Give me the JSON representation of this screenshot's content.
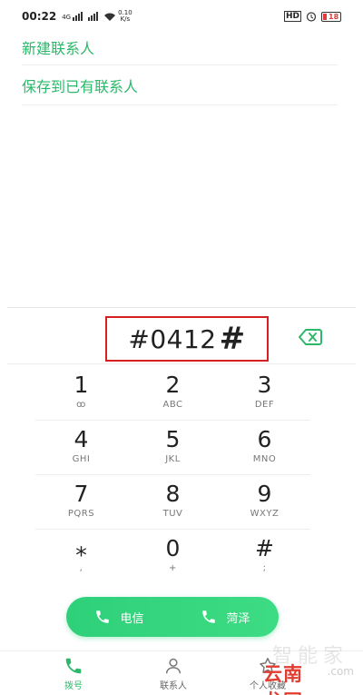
{
  "status_bar": {
    "time": "00:22",
    "net_label": "4G",
    "speed_value": "0.10",
    "speed_unit": "K/s",
    "hd": "HD",
    "battery": "18"
  },
  "suggestions": {
    "new_contact": "新建联系人",
    "save_existing": "保存到已有联系人"
  },
  "dialer": {
    "number": "#0412",
    "hash": "#"
  },
  "keypad": [
    {
      "digit": "1",
      "letters": "ꝏ"
    },
    {
      "digit": "2",
      "letters": "ABC"
    },
    {
      "digit": "3",
      "letters": "DEF"
    },
    {
      "digit": "4",
      "letters": "GHI"
    },
    {
      "digit": "5",
      "letters": "JKL"
    },
    {
      "digit": "6",
      "letters": "MNO"
    },
    {
      "digit": "7",
      "letters": "PQRS"
    },
    {
      "digit": "8",
      "letters": "TUV"
    },
    {
      "digit": "9",
      "letters": "WXYZ"
    },
    {
      "digit": "⁎",
      "letters": ","
    },
    {
      "digit": "0",
      "letters": "+"
    },
    {
      "digit": "#",
      "letters": ";"
    }
  ],
  "call": {
    "sim1": "电信",
    "sim2": "菏泽"
  },
  "nav": {
    "dial": "拨号",
    "contacts": "联系人",
    "favorites": "个人收藏"
  },
  "watermark": {
    "top": "智能家",
    "main": "云南龙网",
    "sub": ".com"
  },
  "colors": {
    "accent": "#2cb86a",
    "highlight_box": "#d42020",
    "call_bar": "#3ddc84"
  }
}
